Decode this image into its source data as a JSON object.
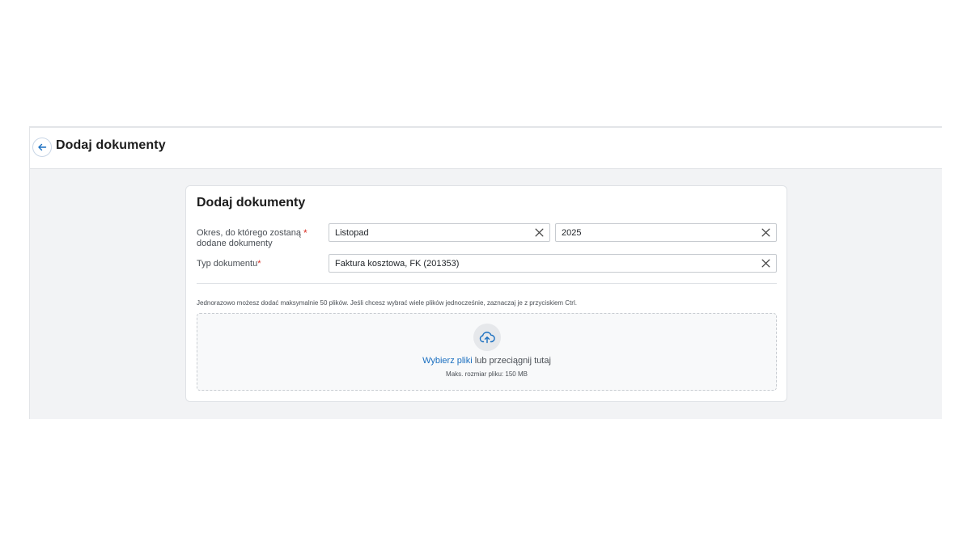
{
  "header": {
    "title": "Dodaj dokumenty",
    "back_icon": "arrow-left-icon"
  },
  "form": {
    "title": "Dodaj dokumenty",
    "period": {
      "label_line1": "Okres, do którego zostaną",
      "label_line2": "dodane dokumenty",
      "required_mark": "*",
      "month_value": "Listopad",
      "year_value": "2025"
    },
    "doc_type": {
      "label": "Typ dokumentu",
      "required_mark": "*",
      "value": "Faktura kosztowa, FK (201353)"
    },
    "hint": "Jednorazowo możesz dodać maksymalnie 50 plików. Jeśli chcesz wybrać wiele plików jednocześnie, zaznaczaj je z przyciskiem Ctrl.",
    "dropzone": {
      "icon": "cloud-upload-icon",
      "link_text": "Wybierz pliki",
      "rest_text": " lub przeciągnij tutaj",
      "max_size": "Maks. rozmiar pliku: 150 MB"
    }
  },
  "colors": {
    "accent": "#1a6fc0",
    "required": "#d93025",
    "background": "#f2f3f5"
  }
}
